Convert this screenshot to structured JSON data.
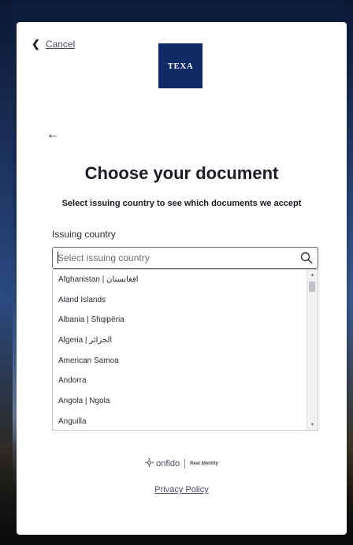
{
  "header": {
    "cancel_label": "Cancel",
    "logo_text": "TEXA"
  },
  "main": {
    "title": "Choose your document",
    "subtitle": "Select issuing country to see which documents we accept",
    "field_label": "Issuing country",
    "search_placeholder": "Select issuing country"
  },
  "countries": [
    "Afghanistan | افغانستان",
    "Aland Islands",
    "Albania | Shqipëria",
    "Algeria | الجزائر",
    "American Samoa",
    "Andorra",
    "Angola | Ngola",
    "Anguilla"
  ],
  "footer": {
    "brand": "onfido",
    "tagline": "Real Identity",
    "privacy_label": "Privacy Policy"
  },
  "colors": {
    "logo_bg": "#0d2a66",
    "link": "#4a4a78",
    "title": "#1b1b24"
  }
}
